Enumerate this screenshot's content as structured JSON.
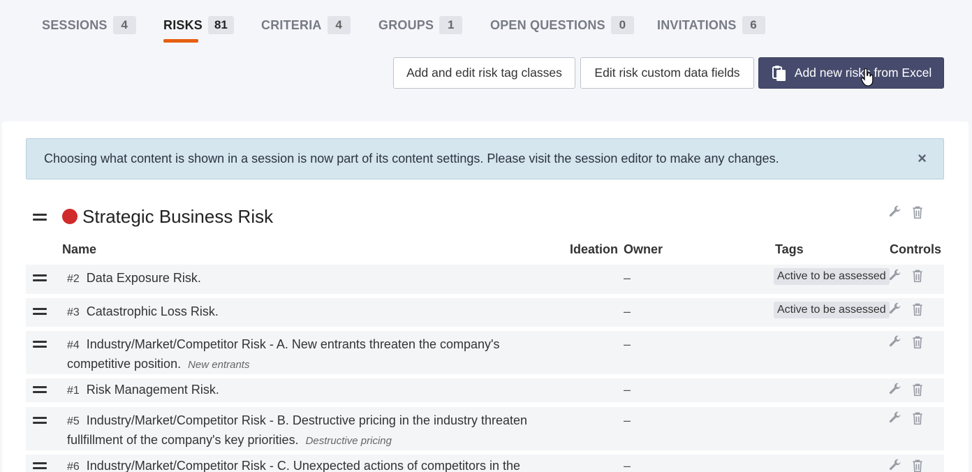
{
  "tabs": [
    {
      "label": "SESSIONS",
      "count": "4"
    },
    {
      "label": "RISKS",
      "count": "81"
    },
    {
      "label": "CRITERIA",
      "count": "4"
    },
    {
      "label": "GROUPS",
      "count": "1"
    },
    {
      "label": "OPEN QUESTIONS",
      "count": "0"
    },
    {
      "label": "INVITATIONS",
      "count": "6"
    }
  ],
  "actions": {
    "tag_classes": "Add and edit risk tag classes",
    "custom_fields": "Edit risk custom data fields",
    "add_from_excel": "Add new risks from Excel"
  },
  "alert": {
    "text": "Choosing what content is shown in a session is now part of its content settings. Please visit the session editor to make any changes.",
    "close": "×"
  },
  "group": {
    "title": "Strategic Business Risk",
    "color": "#d12a2a"
  },
  "columns": {
    "name": "Name",
    "ideation": "Ideation",
    "owner": "Owner",
    "tags": "Tags",
    "controls": "Controls"
  },
  "risks": [
    {
      "num": "#2",
      "name": "Data Exposure Risk.",
      "sub": "",
      "owner": "–",
      "tag": "Active to be assessed"
    },
    {
      "num": "#3",
      "name": "Catastrophic Loss Risk.",
      "sub": "",
      "owner": "–",
      "tag": "Active to be assessed"
    },
    {
      "num": "#4",
      "name": "Industry/Market/Competitor Risk - A. New entrants threaten the company's competitive position.",
      "sub": "New entrants",
      "owner": "–",
      "tag": ""
    },
    {
      "num": "#1",
      "name": "Risk Management Risk.",
      "sub": "",
      "owner": "–",
      "tag": ""
    },
    {
      "num": "#5",
      "name": "Industry/Market/Competitor Risk - B. Destructive pricing in the industry threaten fullfillment of the company's key priorities.",
      "sub": "Destructive pricing",
      "owner": "–",
      "tag": ""
    },
    {
      "num": "#6",
      "name": "Industry/Market/Competitor Risk - C. Unexpected actions of competitors in the",
      "sub": "",
      "owner": "–",
      "tag": ""
    }
  ],
  "colors": {
    "accent": "#e55f11",
    "primary_button": "#464b6d",
    "alert_bg": "#d5e6ee"
  }
}
